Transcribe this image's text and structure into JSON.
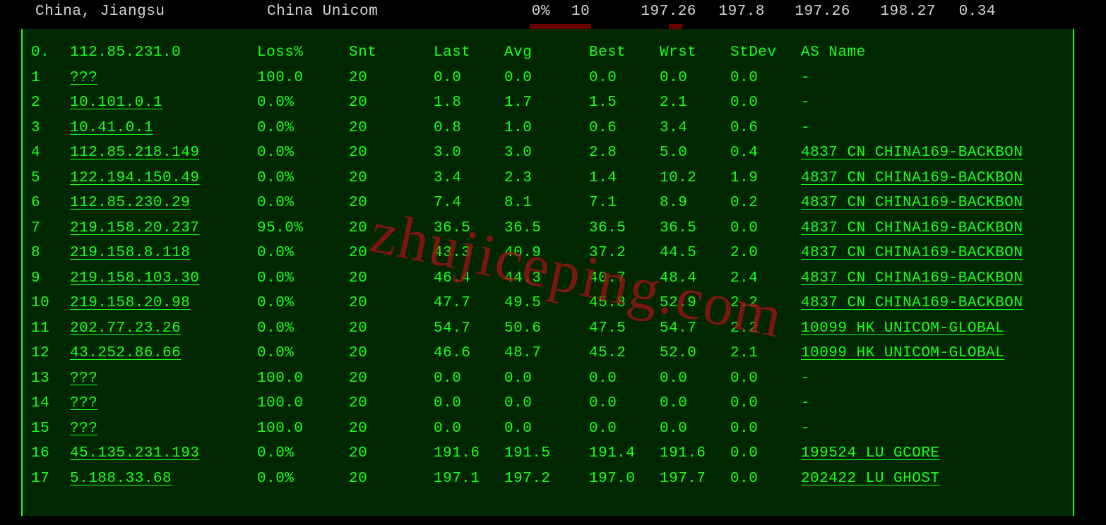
{
  "header": {
    "region": "China, Jiangsu",
    "isp": "China Unicom",
    "loss": "0%",
    "count": "10",
    "v1": "197.26",
    "v2": "197.8",
    "v3": "197.26",
    "v4": "198.27",
    "v5": "0.34"
  },
  "tableHeader": {
    "hop": "0.",
    "ip": "112.85.231.0",
    "loss": "Loss%",
    "snt": "Snt",
    "last": "Last",
    "avg": "Avg",
    "best": "Best",
    "wrst": "Wrst",
    "stdev": "StDev",
    "as": "AS Name"
  },
  "hops": [
    {
      "n": "1",
      "ip": "???",
      "loss": "100.0",
      "snt": "20",
      "last": "0.0",
      "avg": "0.0",
      "best": "0.0",
      "wrst": "0.0",
      "stdev": "0.0",
      "as": "-"
    },
    {
      "n": "2",
      "ip": "10.101.0.1",
      "loss": "0.0%",
      "snt": "20",
      "last": "1.8",
      "avg": "1.7",
      "best": "1.5",
      "wrst": "2.1",
      "stdev": "0.0",
      "as": "-"
    },
    {
      "n": "3",
      "ip": "10.41.0.1",
      "loss": "0.0%",
      "snt": "20",
      "last": "0.8",
      "avg": "1.0",
      "best": "0.6",
      "wrst": "3.4",
      "stdev": "0.6",
      "as": "-"
    },
    {
      "n": "4",
      "ip": "112.85.218.149",
      "loss": "0.0%",
      "snt": "20",
      "last": "3.0",
      "avg": "3.0",
      "best": "2.8",
      "wrst": "5.0",
      "stdev": "0.4",
      "as": "4837   CN CHINA169-BACKBON"
    },
    {
      "n": "5",
      "ip": "122.194.150.49",
      "loss": "0.0%",
      "snt": "20",
      "last": "3.4",
      "avg": "2.3",
      "best": "1.4",
      "wrst": "10.2",
      "stdev": "1.9",
      "as": "4837   CN CHINA169-BACKBON"
    },
    {
      "n": "6",
      "ip": "112.85.230.29",
      "loss": "0.0%",
      "snt": "20",
      "last": "7.4",
      "avg": "8.1",
      "best": "7.1",
      "wrst": "8.9",
      "stdev": "0.2",
      "as": "4837   CN CHINA169-BACKBON"
    },
    {
      "n": "7",
      "ip": "219.158.20.237",
      "loss": "95.0%",
      "snt": "20",
      "last": "36.5",
      "avg": "36.5",
      "best": "36.5",
      "wrst": "36.5",
      "stdev": "0.0",
      "as": "4837   CN CHINA169-BACKBON"
    },
    {
      "n": "8",
      "ip": "219.158.8.118",
      "loss": "0.0%",
      "snt": "20",
      "last": "43.3",
      "avg": "40.9",
      "best": "37.2",
      "wrst": "44.5",
      "stdev": "2.0",
      "as": "4837   CN CHINA169-BACKBON"
    },
    {
      "n": "9",
      "ip": "219.158.103.30",
      "loss": "0.0%",
      "snt": "20",
      "last": "46.4",
      "avg": "44.3",
      "best": "40.7",
      "wrst": "48.4",
      "stdev": "2.4",
      "as": "4837   CN CHINA169-BACKBON"
    },
    {
      "n": "10",
      "ip": "219.158.20.98",
      "loss": "0.0%",
      "snt": "20",
      "last": "47.7",
      "avg": "49.5",
      "best": "45.8",
      "wrst": "52.9",
      "stdev": "2.2",
      "as": "4837   CN CHINA169-BACKBON"
    },
    {
      "n": "11",
      "ip": "202.77.23.26",
      "loss": "0.0%",
      "snt": "20",
      "last": "54.7",
      "avg": "50.6",
      "best": "47.5",
      "wrst": "54.7",
      "stdev": "2.2",
      "as": "10099  HK UNICOM-GLOBAL"
    },
    {
      "n": "12",
      "ip": "43.252.86.66",
      "loss": "0.0%",
      "snt": "20",
      "last": "46.6",
      "avg": "48.7",
      "best": "45.2",
      "wrst": "52.0",
      "stdev": "2.1",
      "as": "10099  HK UNICOM-GLOBAL"
    },
    {
      "n": "13",
      "ip": "???",
      "loss": "100.0",
      "snt": "20",
      "last": "0.0",
      "avg": "0.0",
      "best": "0.0",
      "wrst": "0.0",
      "stdev": "0.0",
      "as": "-"
    },
    {
      "n": "14",
      "ip": "???",
      "loss": "100.0",
      "snt": "20",
      "last": "0.0",
      "avg": "0.0",
      "best": "0.0",
      "wrst": "0.0",
      "stdev": "0.0",
      "as": "-"
    },
    {
      "n": "15",
      "ip": "???",
      "loss": "100.0",
      "snt": "20",
      "last": "0.0",
      "avg": "0.0",
      "best": "0.0",
      "wrst": "0.0",
      "stdev": "0.0",
      "as": "-"
    },
    {
      "n": "16",
      "ip": "45.135.231.193",
      "loss": "0.0%",
      "snt": "20",
      "last": "191.6",
      "avg": "191.5",
      "best": "191.4",
      "wrst": "191.6",
      "stdev": "0.0",
      "as": "199524 LU GCORE"
    },
    {
      "n": "17",
      "ip": "5.188.33.68",
      "loss": "0.0%",
      "snt": "20",
      "last": "197.1",
      "avg": "197.2",
      "best": "197.0",
      "wrst": "197.7",
      "stdev": "0.0",
      "as": "202422 LU GHOST"
    }
  ],
  "watermark": "zhujiceping.com"
}
